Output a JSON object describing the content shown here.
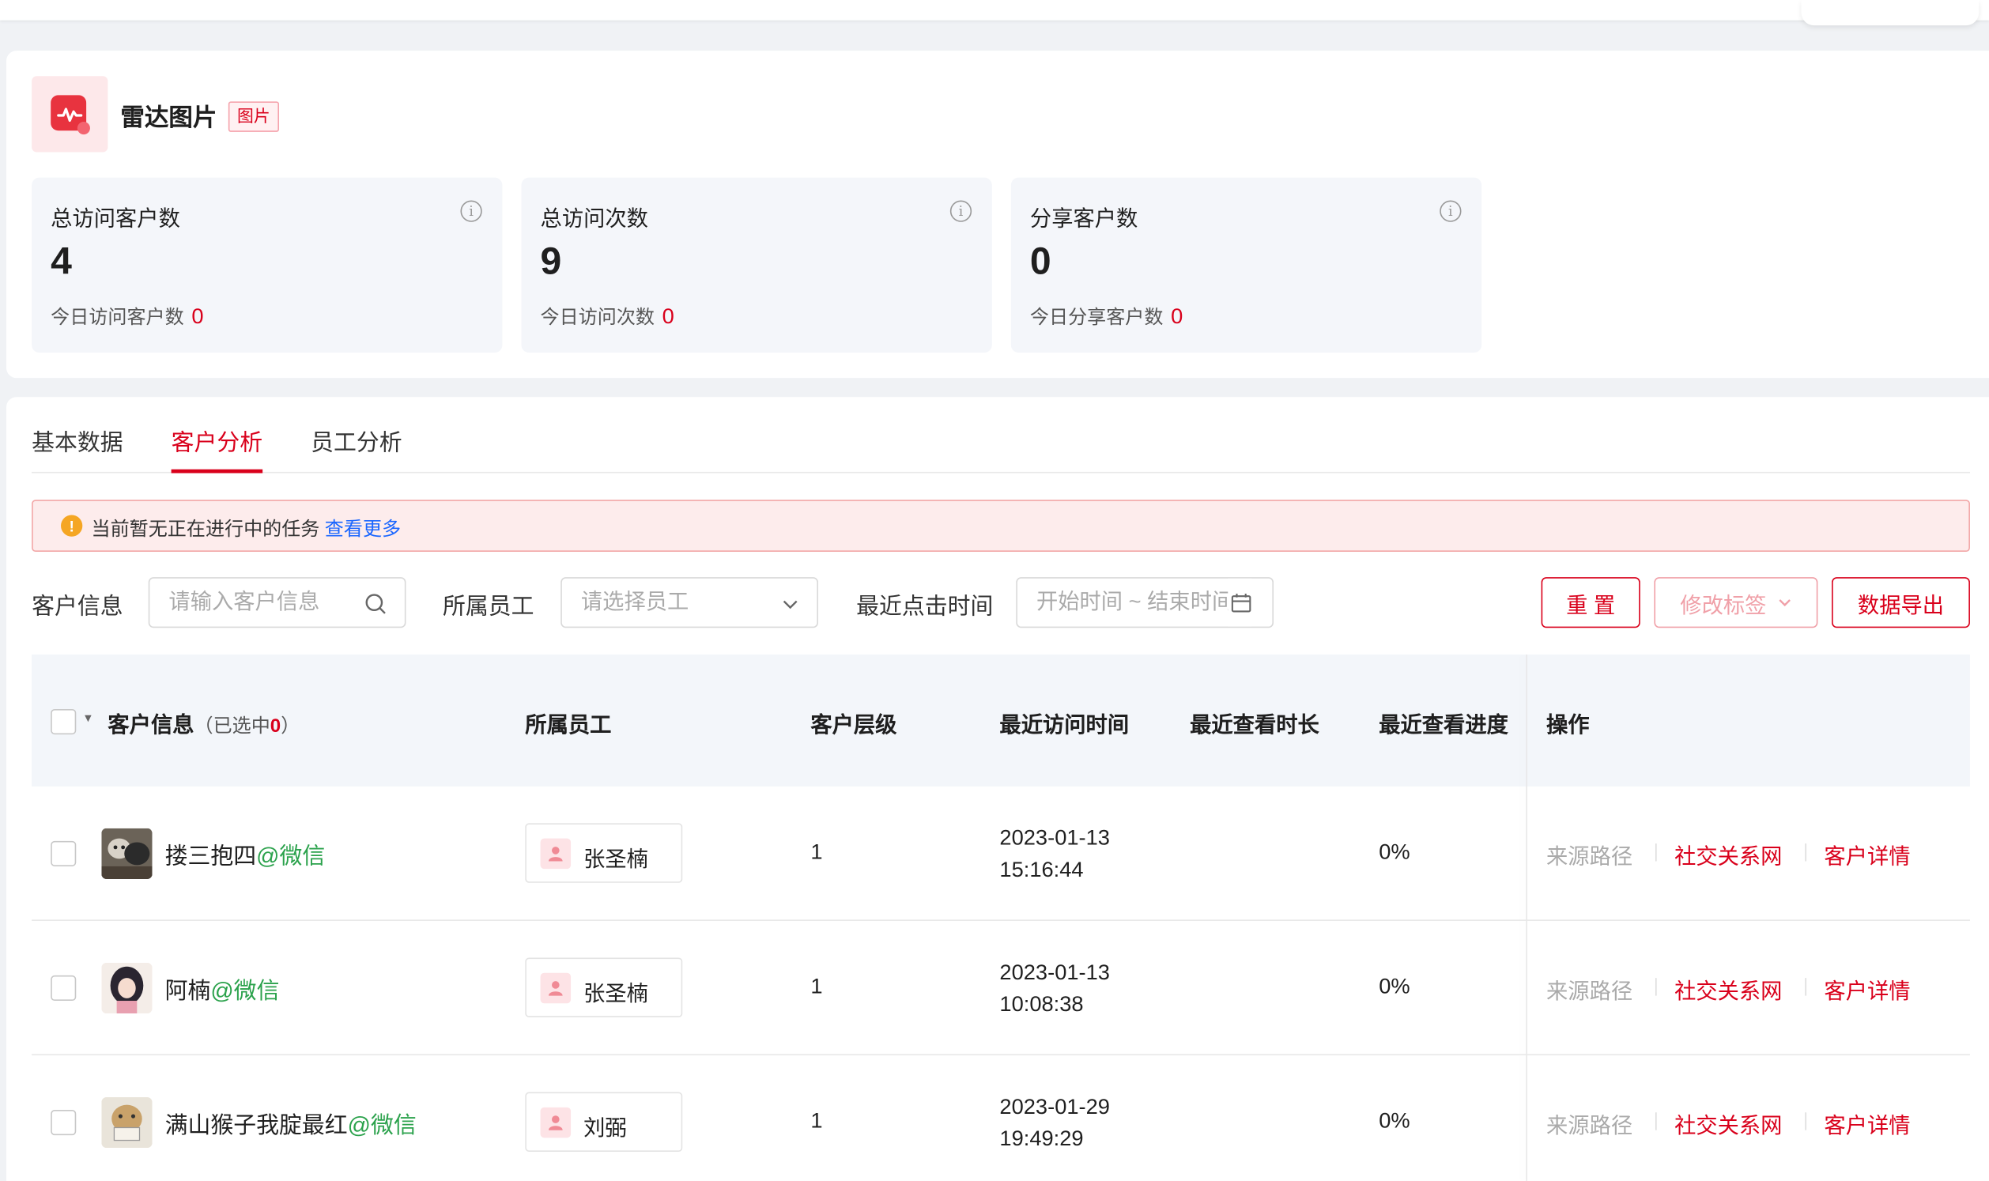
{
  "material": {
    "title": "雷达图片",
    "tag": "图片"
  },
  "stats": [
    {
      "label": "总访问客户数",
      "value": "4",
      "sub_label": "今日访问客户数",
      "sub_value": "0"
    },
    {
      "label": "总访问次数",
      "value": "9",
      "sub_label": "今日访问次数",
      "sub_value": "0"
    },
    {
      "label": "分享客户数",
      "value": "0",
      "sub_label": "今日分享客户数",
      "sub_value": "0"
    }
  ],
  "tabs": [
    {
      "label": "基本数据",
      "active": false
    },
    {
      "label": "客户分析",
      "active": true
    },
    {
      "label": "员工分析",
      "active": false
    }
  ],
  "alert": {
    "text": "当前暂无正在进行中的任务",
    "link": "查看更多"
  },
  "filters": {
    "customer_label": "客户信息",
    "customer_placeholder": "请输入客户信息",
    "staff_label": "所属员工",
    "staff_placeholder": "请选择员工",
    "time_label": "最近点击时间",
    "time_placeholder": "开始时间 ~ 结束时间"
  },
  "buttons": {
    "reset": "重 置",
    "edit_tag": "修改标签",
    "export": "数据导出"
  },
  "table": {
    "headers": {
      "customer": "客户信息",
      "selected_prefix": "（已选中",
      "selected_count": "0",
      "selected_suffix": "）",
      "staff": "所属员工",
      "level": "客户层级",
      "last_visit": "最近访问时间",
      "duration": "最近查看时长",
      "progress": "最近查看进度",
      "ops": "操作"
    },
    "rows": [
      {
        "name": "搂三抱四",
        "source": "@微信",
        "staff": "张圣楠",
        "level": "1",
        "date": "2023-01-13",
        "time": "15:16:44",
        "duration": "",
        "progress": "0%"
      },
      {
        "name": "阿楠",
        "source": "@微信",
        "staff": "张圣楠",
        "level": "1",
        "date": "2023-01-13",
        "time": "10:08:38",
        "duration": "",
        "progress": "0%"
      },
      {
        "name": "满山猴子我腚最红",
        "source": "@微信",
        "staff": "刘弼",
        "level": "1",
        "date": "2023-01-29",
        "time": "19:49:29",
        "duration": "",
        "progress": "0%"
      }
    ],
    "actions": {
      "source_path": "来源路径",
      "social": "社交关系网",
      "detail": "客户详情"
    }
  },
  "colors": {
    "accent": "#d9001b",
    "wechat": "#2ba24c",
    "link": "#1a66ff",
    "warning": "#f5a623"
  }
}
